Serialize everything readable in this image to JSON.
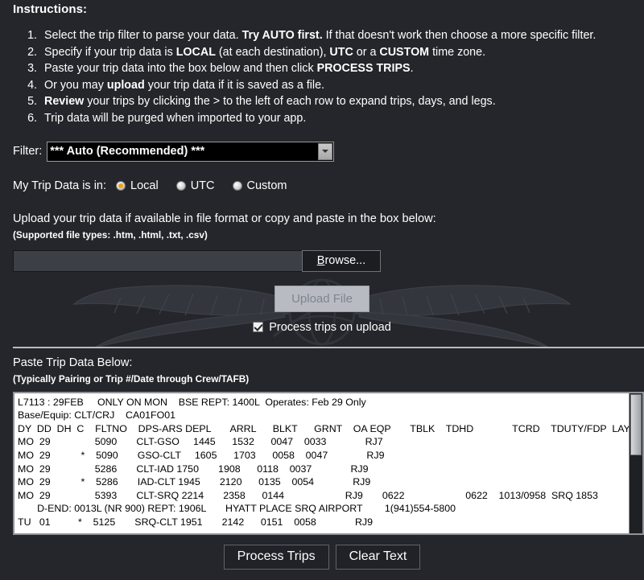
{
  "instructions": {
    "title": "Instructions:",
    "items": [
      {
        "parts": [
          {
            "t": "Select the trip filter to parse your data.  ",
            "b": false
          },
          {
            "t": "Try AUTO first.",
            "b": true
          },
          {
            "t": " If that doesn't work then choose a more specific filter.",
            "b": false
          }
        ]
      },
      {
        "parts": [
          {
            "t": "Specify if your trip data is ",
            "b": false
          },
          {
            "t": "LOCAL",
            "b": true
          },
          {
            "t": " (at each destination), ",
            "b": false
          },
          {
            "t": "UTC",
            "b": true
          },
          {
            "t": " or a ",
            "b": false
          },
          {
            "t": "CUSTOM",
            "b": true
          },
          {
            "t": " time zone.",
            "b": false
          }
        ]
      },
      {
        "parts": [
          {
            "t": "Paste your trip data into the box below and then click ",
            "b": false
          },
          {
            "t": "PROCESS TRIPS",
            "b": true
          },
          {
            "t": ".",
            "b": false
          }
        ]
      },
      {
        "parts": [
          {
            "t": "Or you may ",
            "b": false
          },
          {
            "t": "upload",
            "b": true
          },
          {
            "t": " your trip data if it is saved as a file.",
            "b": false
          }
        ]
      },
      {
        "parts": [
          {
            "t": "Review",
            "b": true
          },
          {
            "t": " your trips by clicking the > to the left of each row to expand trips, days, and legs.",
            "b": false
          }
        ]
      },
      {
        "parts": [
          {
            "t": "Trip data will be purged when imported to your app.",
            "b": false
          }
        ]
      }
    ]
  },
  "filter": {
    "label": "Filter:",
    "selected": "*** Auto (Recommended) ***",
    "caret_icon": "chevron-down-icon"
  },
  "timezone": {
    "label": "My Trip Data is in:",
    "options": [
      {
        "label": "Local",
        "selected": true
      },
      {
        "label": "UTC",
        "selected": false
      },
      {
        "label": "Custom",
        "selected": false
      }
    ],
    "selected_color": "#f2a310"
  },
  "upload": {
    "heading": "Upload your trip data if available in file format or copy and paste in the box below:",
    "subheading": "(Supported file types: .htm, .html, .txt, .csv)",
    "file_value": "",
    "browse_label_underlined": "B",
    "browse_label_rest": "rowse...",
    "upload_button": "Upload File",
    "upload_button_disabled": true,
    "checkbox_label": "Process trips on upload",
    "checkbox_checked": true
  },
  "paste": {
    "heading": "Paste Trip Data Below:",
    "subheading": "(Typically Pairing or Trip #/Date through Crew/TAFB)",
    "lines": [
      "L7113 : 29FEB     ONLY ON MON    BSE REPT: 1400L  Operates: Feb 29 Only",
      "Base/Equip: CLT/CRJ    CA01FO01",
      "DY  DD  DH  C    FLTNO    DPS-ARS DEPL       ARRL      BLKT      GRNT    OA EQP       TBLK    TDHD              TCRD    TDUTY/FDP  LAYOVER",
      "MO  29                5090       CLT-GSO     1445      1532      0047    0033              RJ7",
      "MO  29           *    5090       GSO-CLT     1605      1703      0058    0047              RJ9",
      "MO  29                5286       CLT-IAD 1750       1908      0118    0037              RJ9",
      "MO  29           *    5286       IAD-CLT 1945       2120      0135    0054              RJ9",
      "MO  29                5393       CLT-SRQ 2214       2358      0144                      RJ9       0622                      0622    1013/0958  SRQ 1853",
      "       D-END: 0013L (NR 900) REPT: 1906L       HYATT PLACE SRQ AIRPORT        1(941)554-5800",
      "TU   01          *    5125       SRQ-CLT 1951       2142      0151    0058              RJ9"
    ],
    "scrollbar_position": "top"
  },
  "actions": {
    "process_label": "Process Trips",
    "clear_label": "Clear Text"
  },
  "theme": {
    "background": "#24262b",
    "text": "#ffffff",
    "textarea_bg": "#ffffff",
    "textarea_text": "#000000"
  }
}
